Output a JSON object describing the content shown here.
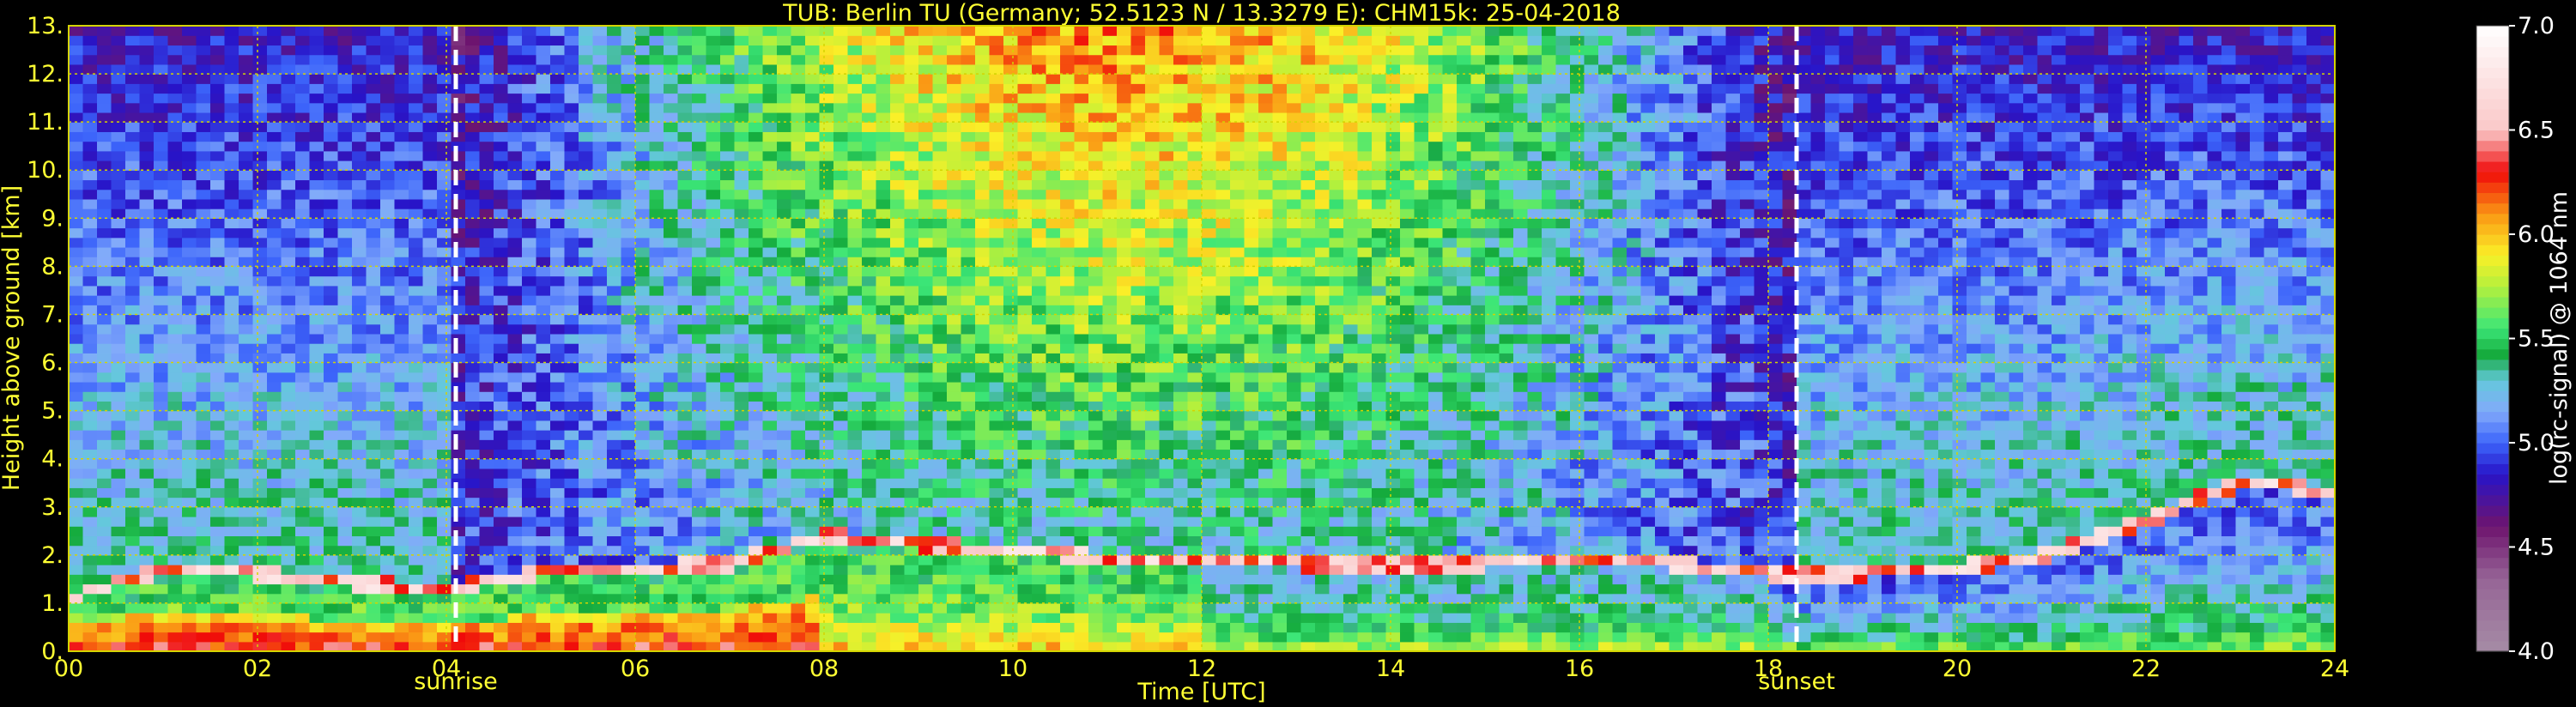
{
  "chart_data": {
    "type": "heatmap",
    "title": "TUB: Berlin TU (Germany; 52.5123 N / 13.3279 E):    CHM15k: 25-04-2018",
    "xlabel": "Time [UTC]",
    "ylabel": "Height above ground [km]",
    "xlim": [
      0,
      24
    ],
    "ylim": [
      0,
      13
    ],
    "x_ticks": [
      "00",
      "02",
      "04",
      "06",
      "08",
      "10",
      "12",
      "14",
      "16",
      "18",
      "20",
      "22",
      "24"
    ],
    "y_ticks": [
      "0.",
      "1.",
      "2.",
      "3.",
      "4.",
      "5.",
      "6.",
      "7.",
      "8.",
      "9.",
      "10.",
      "11.",
      "12.",
      "13."
    ],
    "grid": true,
    "annotations": [
      {
        "label": "sunrise",
        "x": 4.1
      },
      {
        "label": "sunset",
        "x": 18.3
      }
    ],
    "colorbar": {
      "label": "log(rc-signal) @ 1064 nm",
      "range": [
        4.0,
        7.0
      ],
      "ticks": [
        "4.0",
        "4.5",
        "5.0",
        "5.5",
        "6.0",
        "6.5",
        "7.0"
      ]
    },
    "boundary_layer_top_km": {
      "x": [
        0,
        1,
        2,
        3,
        4,
        5,
        6,
        7,
        8,
        9,
        10,
        11,
        12,
        13,
        14,
        15,
        16,
        17,
        18,
        19,
        20,
        21,
        22,
        23,
        24
      ],
      "y": [
        1.0,
        1.6,
        1.5,
        1.3,
        1.2,
        1.5,
        1.6,
        1.7,
        2.3,
        2.1,
        2.0,
        1.8,
        1.8,
        1.7,
        1.7,
        1.7,
        1.8,
        1.7,
        1.5,
        1.5,
        1.6,
        1.9,
        2.6,
        3.4,
        3.2
      ]
    }
  },
  "colors": {
    "text": "#ffff33",
    "grid": "#d4d400",
    "colorbar_text": "#ffffff",
    "background": "#000000"
  }
}
